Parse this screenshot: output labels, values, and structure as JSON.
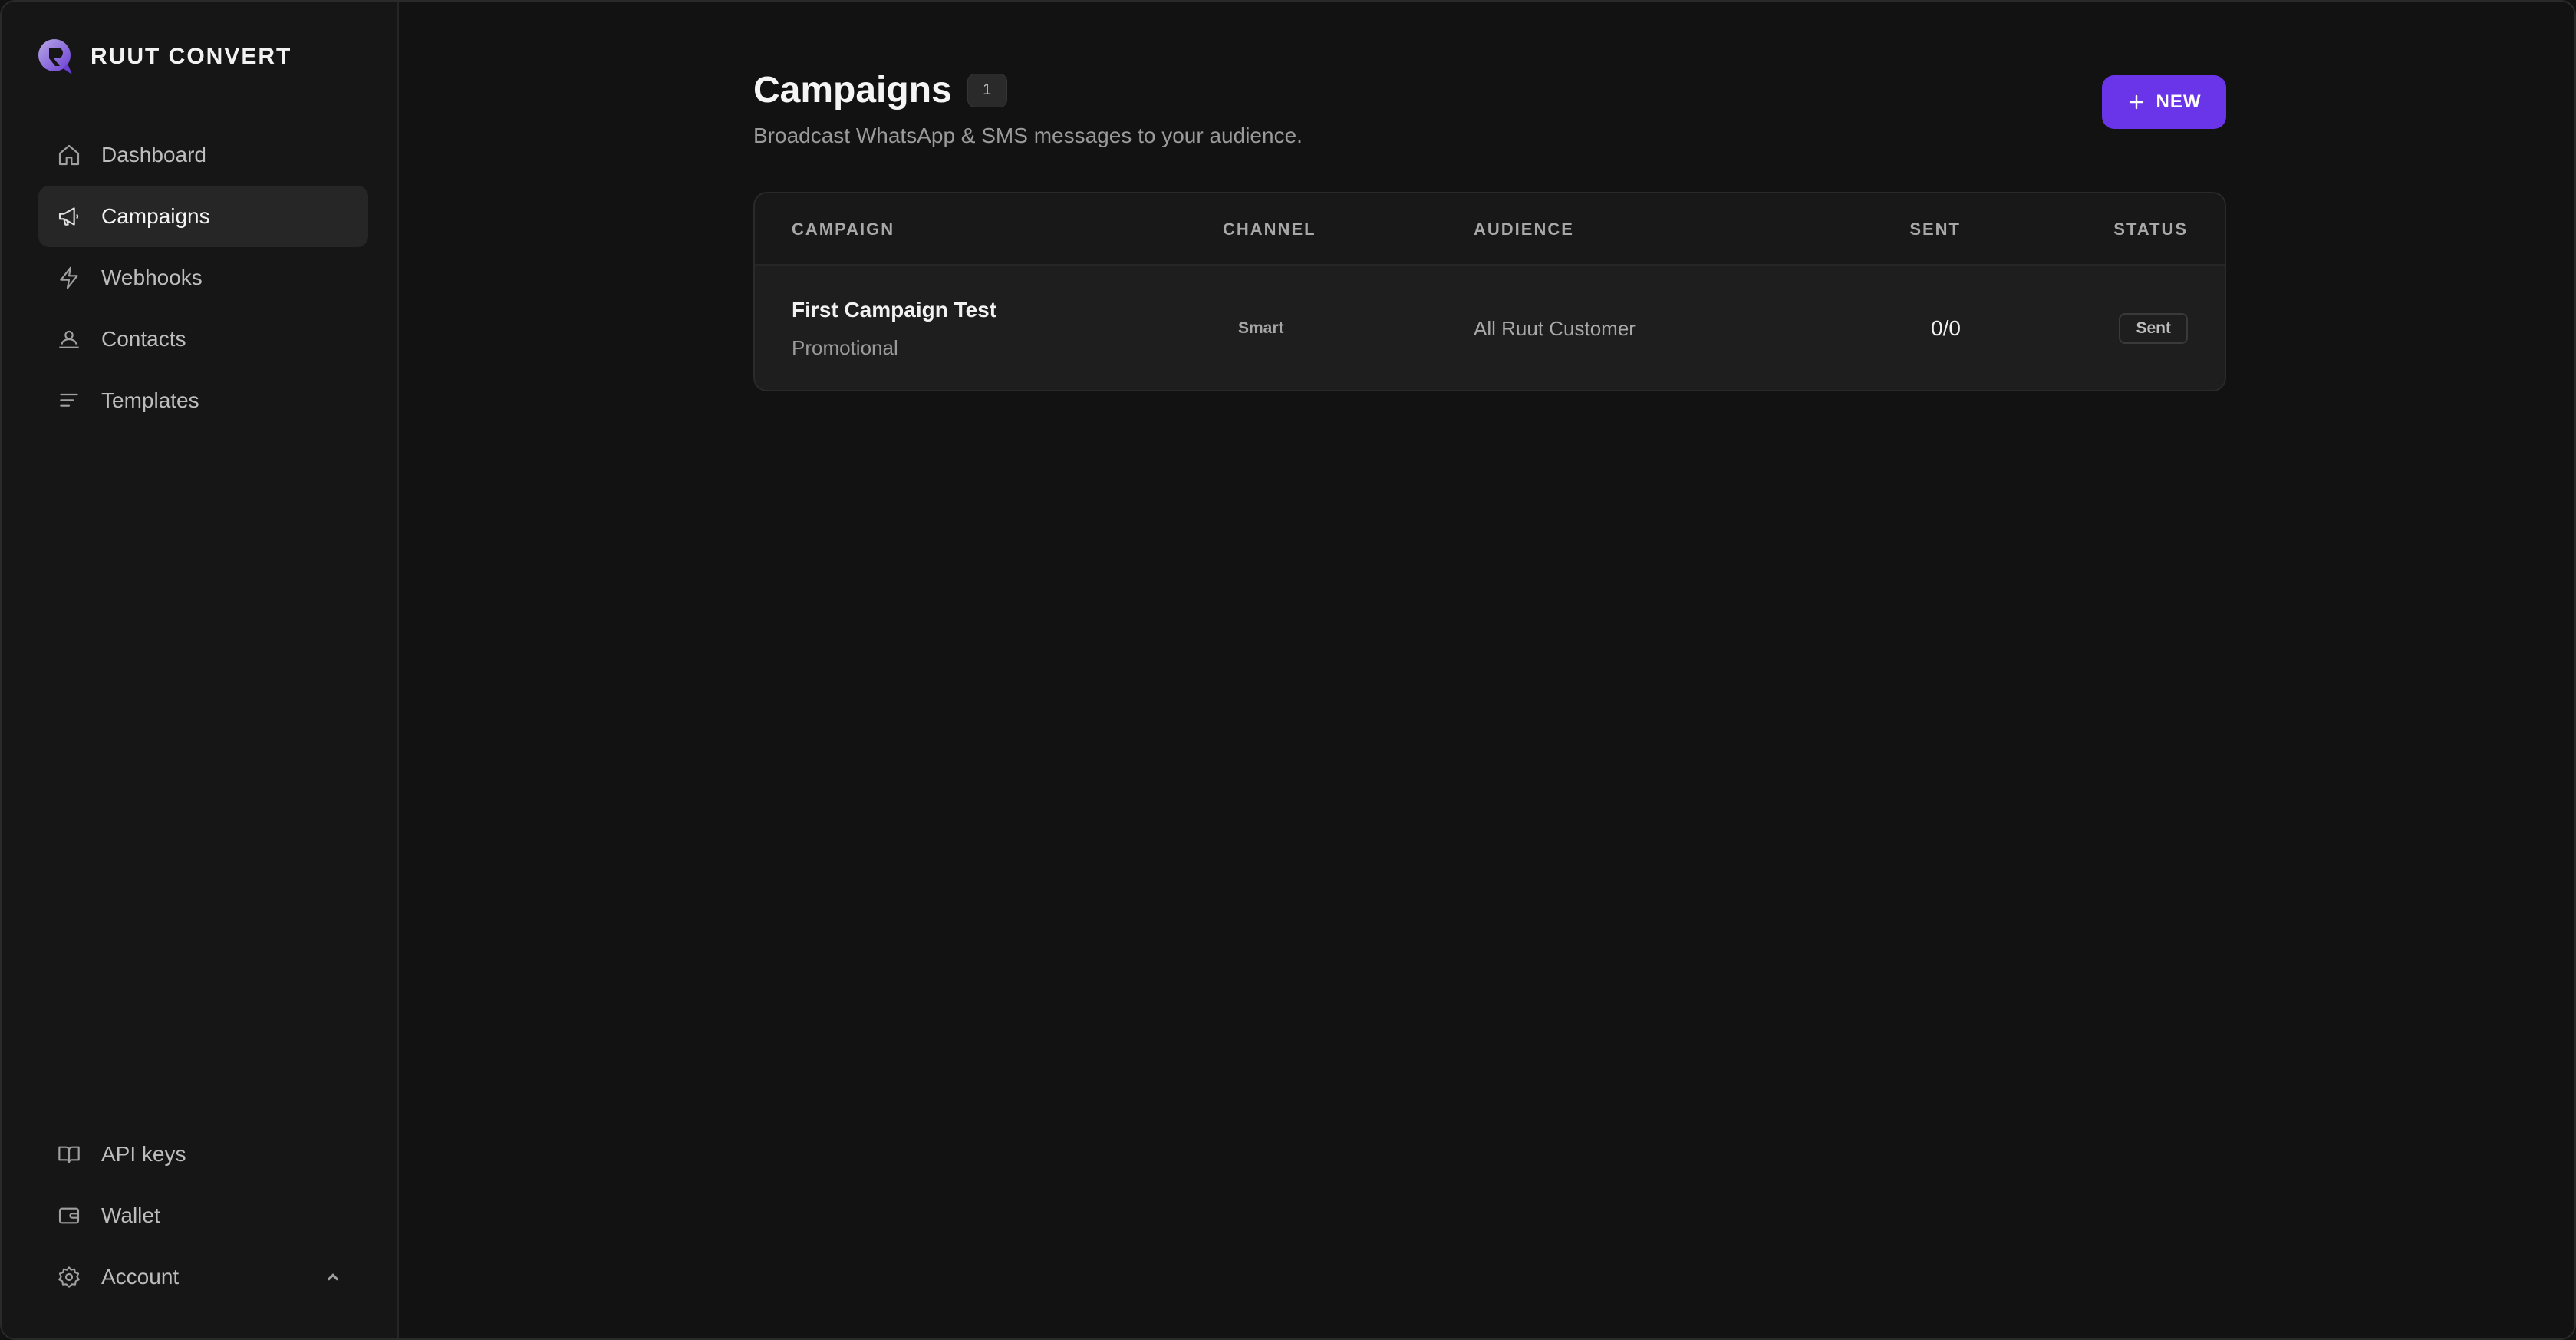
{
  "brand": {
    "name": "RUUT CONVERT",
    "accent": "#7c4dff"
  },
  "sidebar": {
    "items": [
      {
        "label": "Dashboard",
        "icon": "home-icon"
      },
      {
        "label": "Campaigns",
        "icon": "megaphone-icon",
        "active": true
      },
      {
        "label": "Webhooks",
        "icon": "lightning-icon"
      },
      {
        "label": "Contacts",
        "icon": "contacts-icon"
      },
      {
        "label": "Templates",
        "icon": "lines-icon"
      }
    ],
    "bottom": [
      {
        "label": "API keys",
        "icon": "book-icon"
      },
      {
        "label": "Wallet",
        "icon": "wallet-icon"
      },
      {
        "label": "Account",
        "icon": "gear-icon"
      }
    ]
  },
  "header": {
    "title": "Campaigns",
    "count": "1",
    "subtitle": "Broadcast WhatsApp & SMS messages to your audience.",
    "new_label": "NEW"
  },
  "table": {
    "columns": [
      "CAMPAIGN",
      "CHANNEL",
      "AUDIENCE",
      "SENT",
      "STATUS"
    ],
    "rows": [
      {
        "name": "First Campaign Test",
        "type": "Promotional",
        "channel": "Smart",
        "audience": "All Ruut Customer",
        "sent": "0/0",
        "status": "Sent"
      }
    ]
  },
  "colors": {
    "background": "#121212",
    "button": "#6a35e8"
  }
}
